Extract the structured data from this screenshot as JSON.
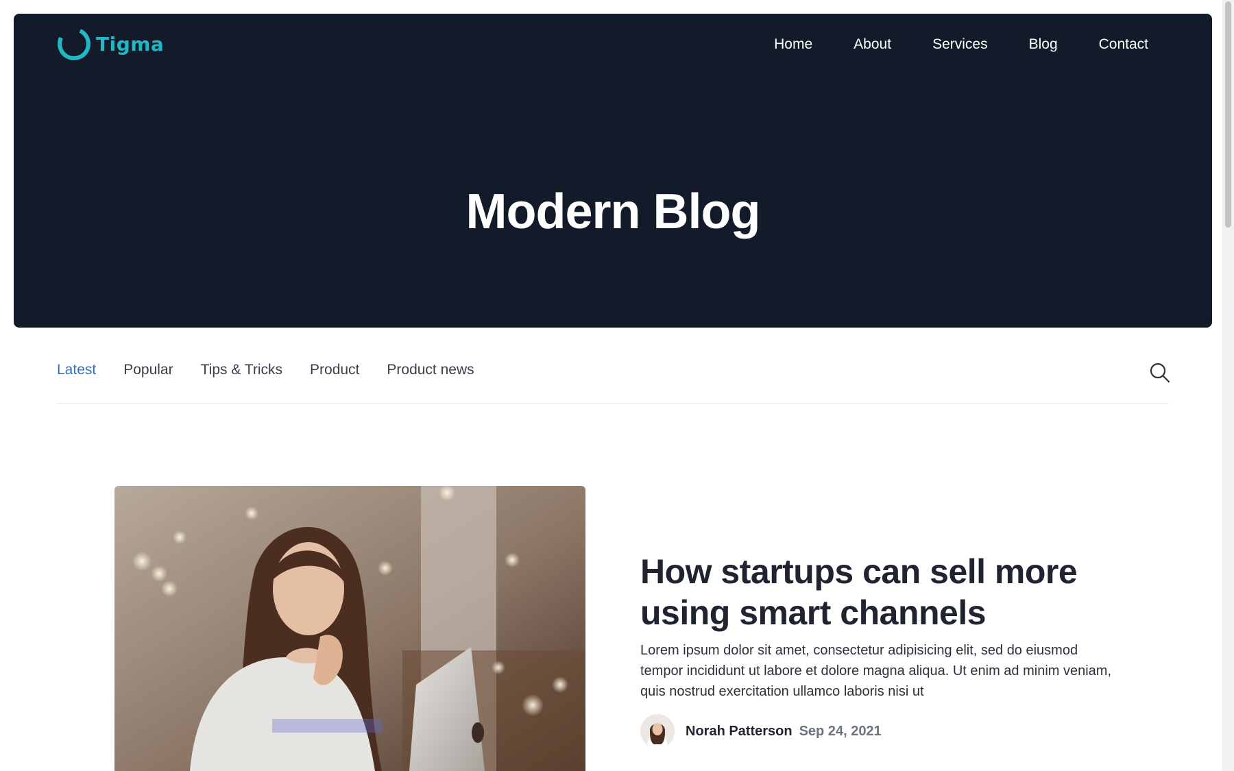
{
  "brand": {
    "name": "Tigma",
    "accent_color": "#1fb9c6"
  },
  "nav": {
    "items": [
      {
        "label": "Home"
      },
      {
        "label": "About"
      },
      {
        "label": "Services"
      },
      {
        "label": "Blog"
      },
      {
        "label": "Contact"
      }
    ]
  },
  "hero": {
    "title": "Modern Blog",
    "background_color": "#131b2b"
  },
  "tabs": {
    "active": "Latest",
    "items": [
      {
        "label": "Latest"
      },
      {
        "label": "Popular"
      },
      {
        "label": "Tips & Tricks"
      },
      {
        "label": "Product"
      },
      {
        "label": "Product news"
      }
    ],
    "search_icon": "search-icon"
  },
  "featured_post": {
    "title": "How startups can sell more using smart channels",
    "excerpt": "Lorem ipsum dolor sit amet, consectetur adipisicing elit, sed do eiusmod tempor incididunt ut labore et dolore magna aliqua. Ut enim ad minim veniam, quis nostrud exercitation ullamco laboris nisi ut",
    "author": "Norah Patterson",
    "date": "Sep 24, 2021"
  }
}
